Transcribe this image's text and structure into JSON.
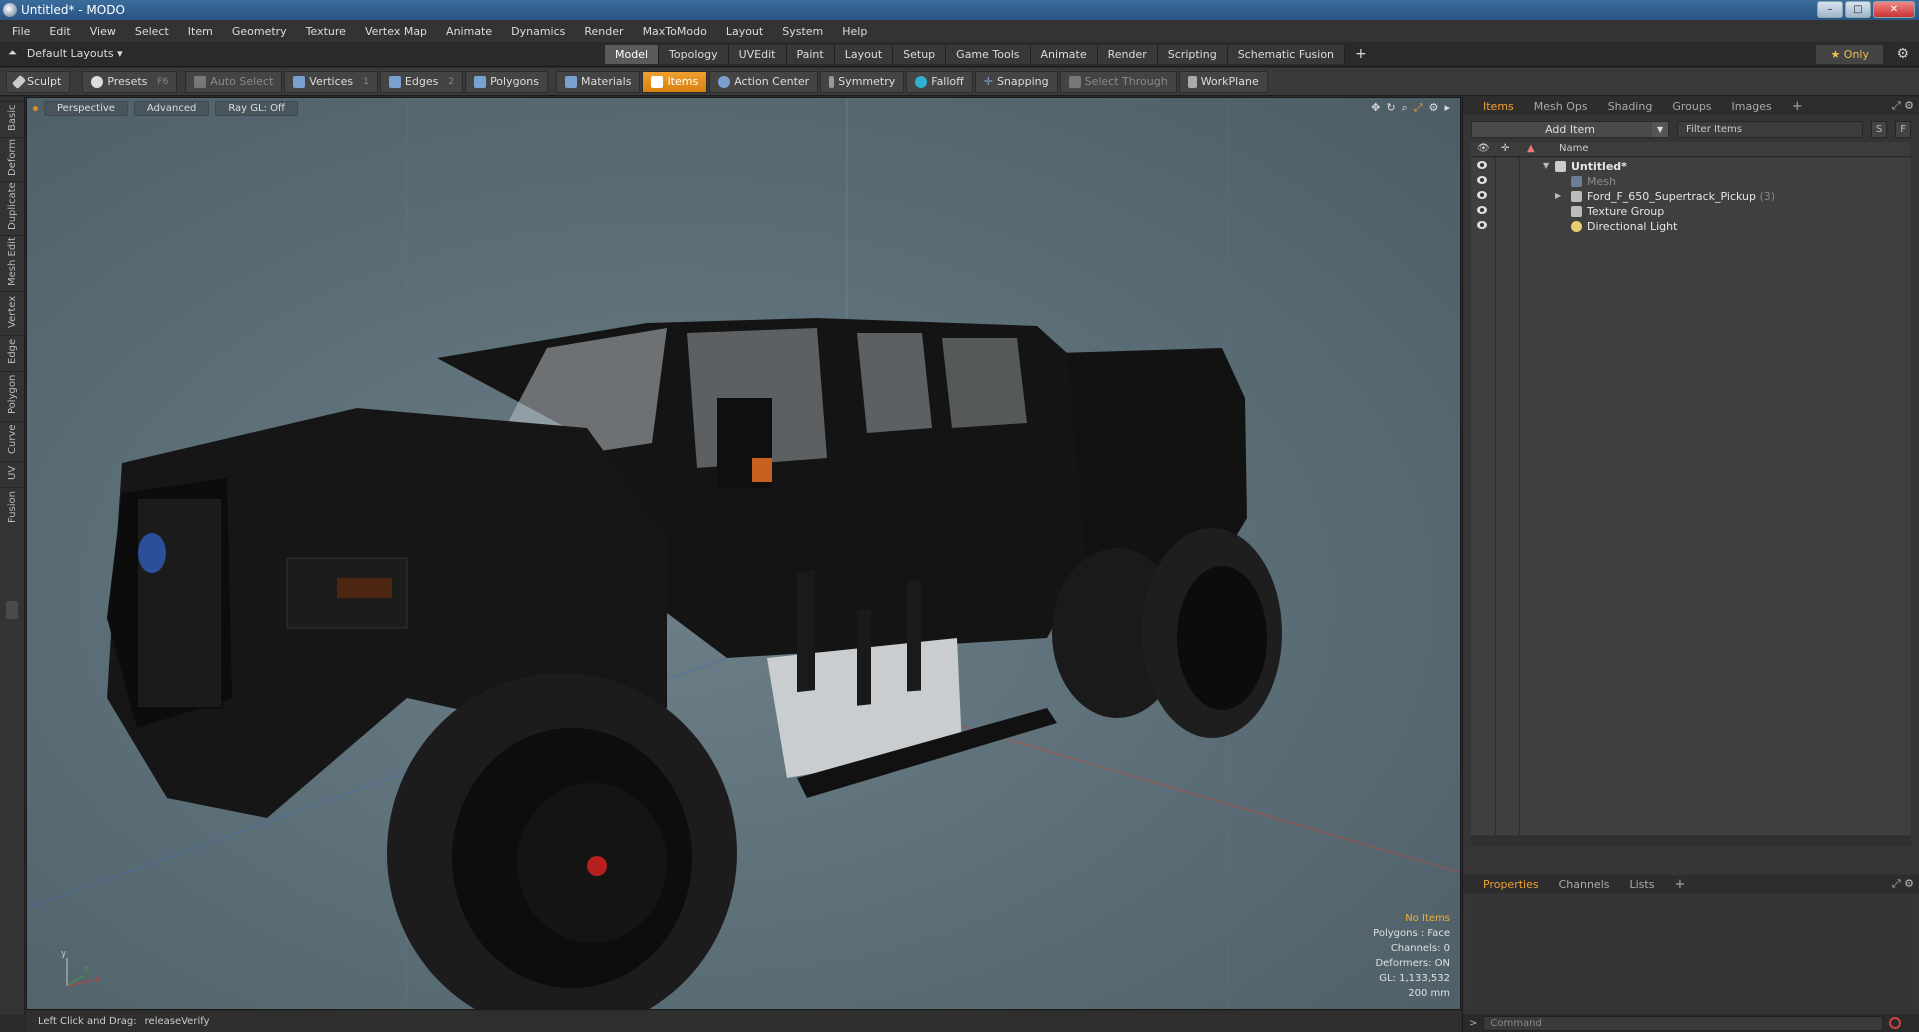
{
  "window": {
    "title": "Untitled* - MODO",
    "min": "–",
    "max": "□",
    "close": "✕"
  },
  "menu": [
    "File",
    "Edit",
    "View",
    "Select",
    "Item",
    "Geometry",
    "Texture",
    "Vertex Map",
    "Animate",
    "Dynamics",
    "Render",
    "MaxToModo",
    "Layout",
    "System",
    "Help"
  ],
  "layoutbar": {
    "layouts_label": "Default Layouts ▾",
    "tabs": [
      "Model",
      "Topology",
      "UVEdit",
      "Paint",
      "Layout",
      "Setup",
      "Game Tools",
      "Animate",
      "Render",
      "Scripting",
      "Schematic Fusion"
    ],
    "active_tab": "Model",
    "add": "+",
    "only": "★ Only"
  },
  "toolbar": {
    "sculpt": "Sculpt",
    "presets": "Presets",
    "presets_key": "F6",
    "auto_select": "Auto Select",
    "vertices": "Vertices",
    "vertices_key": "1",
    "edges": "Edges",
    "edges_key": "2",
    "polygons": "Polygons",
    "materials": "Materials",
    "items": "Items",
    "action_center": "Action Center",
    "symmetry": "Symmetry",
    "falloff": "Falloff",
    "snapping": "Snapping",
    "select_through": "Select Through",
    "workplane": "WorkPlane"
  },
  "left_tabs": [
    "Basic",
    "Deform",
    "Duplicate",
    "Mesh Edit",
    "Vertex",
    "Edge",
    "Polygon",
    "Curve",
    "UV",
    "Fusion"
  ],
  "viewport": {
    "perspective": "Perspective",
    "advanced": "Advanced",
    "raygl": "Ray GL: Off",
    "info": {
      "no_items": "No Items",
      "polygons": "Polygons : Face",
      "channels": "Channels: 0",
      "deformers": "Deformers: ON",
      "gl": "GL: 1,133,532",
      "scale": "200 mm"
    },
    "axes": {
      "x": "x",
      "y": "y",
      "z": "z"
    }
  },
  "statusbar": {
    "hint": "Left Click and Drag:",
    "value": "releaseVerify"
  },
  "items_panel": {
    "tabs": [
      "Items",
      "Mesh Ops",
      "Shading",
      "Groups",
      "Images"
    ],
    "add_tab": "+",
    "add_item": "Add Item",
    "filter": "Filter Items",
    "s_btn": "S",
    "f_btn": "F",
    "column_name": "Name",
    "tree": [
      {
        "label": "Untitled*",
        "count": ""
      },
      {
        "label": "Mesh",
        "count": ""
      },
      {
        "label": "Ford_F_650_Supertrack_Pickup",
        "count": "(3)"
      },
      {
        "label": "Texture Group",
        "count": ""
      },
      {
        "label": "Directional Light",
        "count": ""
      }
    ]
  },
  "properties_panel": {
    "tabs": [
      "Properties",
      "Channels",
      "Lists"
    ],
    "add_tab": "+"
  },
  "command": {
    "prompt": ">",
    "placeholder": "Command"
  },
  "colors": {
    "accent": "#f0a030",
    "viewport_bg": "#5f727b",
    "truck_body": "#151515"
  }
}
